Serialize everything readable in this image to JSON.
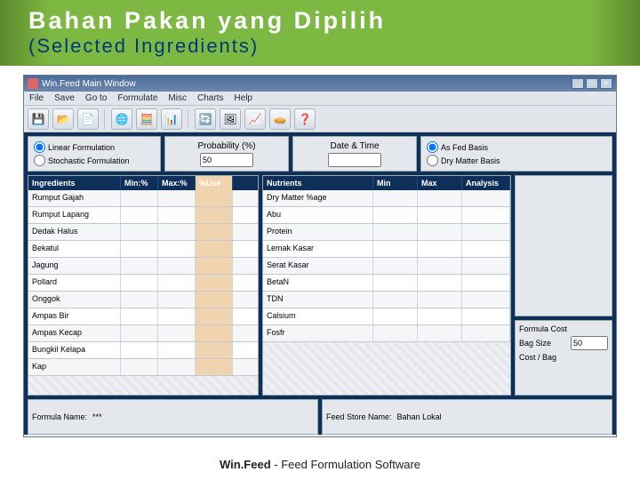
{
  "slide": {
    "title": "Bahan Pakan yang Dipilih",
    "subtitle": "(Selected Ingredients)",
    "footer_bold": "Win.Feed",
    "footer_rest": " - Feed Formulation Software"
  },
  "window": {
    "title": "Win.Feed Main Window",
    "min": "_",
    "max": "□",
    "close": "×"
  },
  "menu": [
    "File",
    "Save",
    "Go to",
    "Formulate",
    "Misc",
    "Charts",
    "Help"
  ],
  "toolbar_icons": [
    "💾",
    "📂",
    "📄",
    "🌐",
    "🧮",
    "📊",
    "|",
    "🔄",
    "🖼",
    "📈",
    "🥧",
    "❓"
  ],
  "toprow": {
    "formulation": {
      "linear": "Linear Formulation",
      "stochastic": "Stochastic Formulation",
      "linear_checked": true,
      "stochastic_checked": false
    },
    "probability": {
      "label": "Probability (%)",
      "value": "50"
    },
    "datetime": {
      "label": "Date & Time",
      "value": ""
    },
    "basis": {
      "asfed": "As Fed Basis",
      "dry": "Dry Matter Basis",
      "asfed_checked": true,
      "dry_checked": false
    }
  },
  "ingredients": {
    "headers": [
      "Ingredients",
      "Min:%",
      "Max:%",
      "%Use"
    ],
    "rows": [
      "Rumput Gajah",
      "Rumput Lapang",
      "Dedak Halus",
      "Bekatul",
      "Jagung",
      "Pollard",
      "Onggok",
      "Ampas Bir",
      "Ampas Kecap",
      "Bungkil Kelapa",
      "Kap"
    ]
  },
  "nutrients": {
    "headers": [
      "Nutrients",
      "Min",
      "Max",
      "Analysis"
    ],
    "rows": [
      "Dry Matter %age",
      "Abu",
      "Protein",
      "Lemak Kasar",
      "Serat Kasar",
      "BetaN",
      "TDN",
      "Calsium",
      "Fosfr"
    ]
  },
  "right": {
    "formula_cost": "Formula Cost",
    "bag_size": "Bag Size",
    "bag_value": "50",
    "cost_bag": "Cost / Bag"
  },
  "bottom": {
    "formula_name_label": "Formula Name:",
    "formula_name_value": "***",
    "feedstore_label": "Feed Store Name:",
    "feedstore_value": "Bahan Lokal"
  }
}
